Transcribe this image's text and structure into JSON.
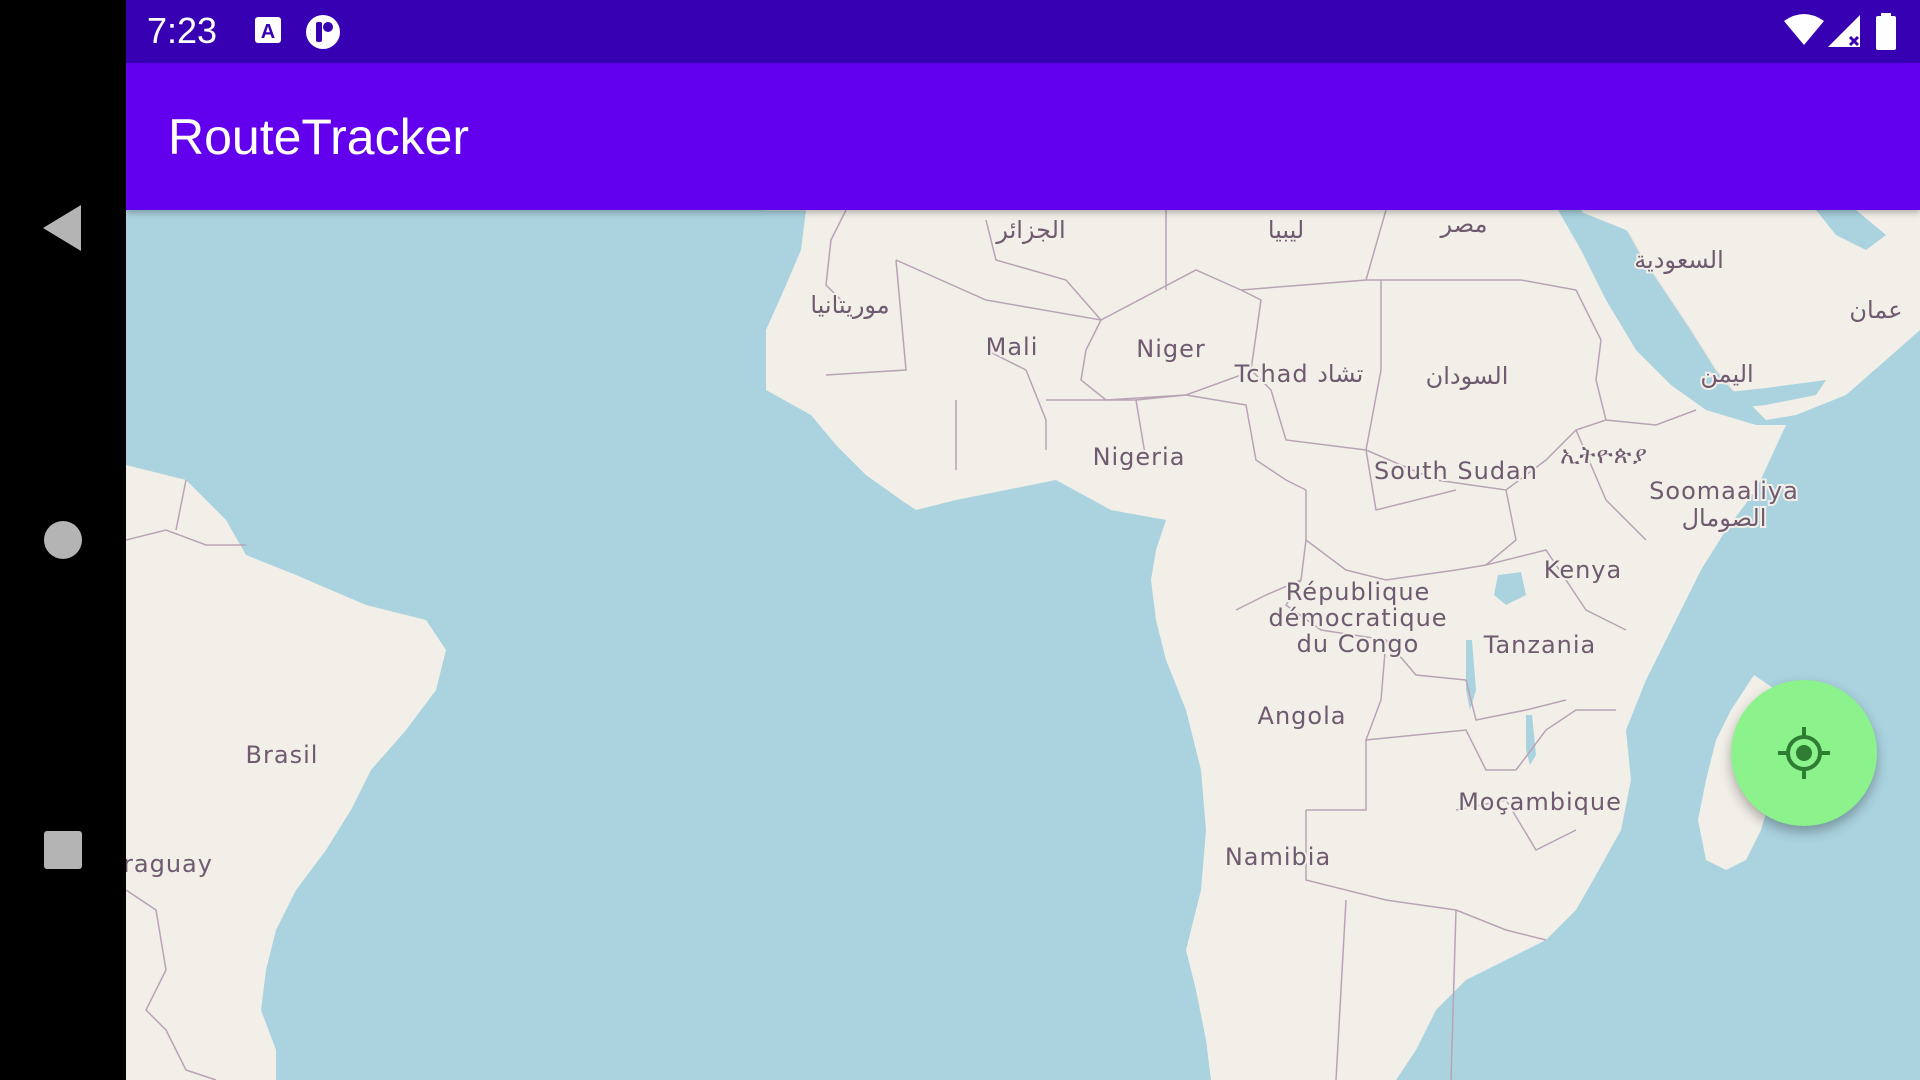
{
  "status_bar": {
    "time": "7:23",
    "icons": [
      "a-notification-icon",
      "app-notification-icon",
      "wifi-icon",
      "signal-icon",
      "battery-icon"
    ]
  },
  "app_bar": {
    "title": "RouteTracker"
  },
  "nav_bar": {
    "buttons": [
      "back-icon",
      "home-icon",
      "recents-icon"
    ]
  },
  "map": {
    "labels": {
      "algeria": "الجزائر",
      "libya": "ليبيا",
      "egypt": "مصر",
      "saudi": "السعودية",
      "mauritania": "موريتانيا",
      "oman": "عمان",
      "mali": "Mali",
      "niger": "Niger",
      "chad": "Tchad تشاد",
      "sudan": "السودان",
      "yemen": "اليمن",
      "nigeria": "Nigeria",
      "ethiopia": "ኢትዮጵያ",
      "south_sudan": "South Sudan",
      "somalia_1": "Soomaaliya",
      "somalia_2": "الصومال",
      "kenya": "Kenya",
      "drc_1": "République",
      "drc_2": "démocratique",
      "drc_3": "du Congo",
      "tanzania": "Tanzania",
      "angola": "Angola",
      "mozambique": "Moçambique",
      "namibia": "Namibia",
      "brazil": "Brasil",
      "paraguay": "raguay"
    },
    "colors": {
      "water": "#aad3df",
      "land": "#f2efe9",
      "border": "#b9a3b5"
    }
  },
  "fab": {
    "icon": "my-location-icon",
    "color": "#8cf28c"
  }
}
